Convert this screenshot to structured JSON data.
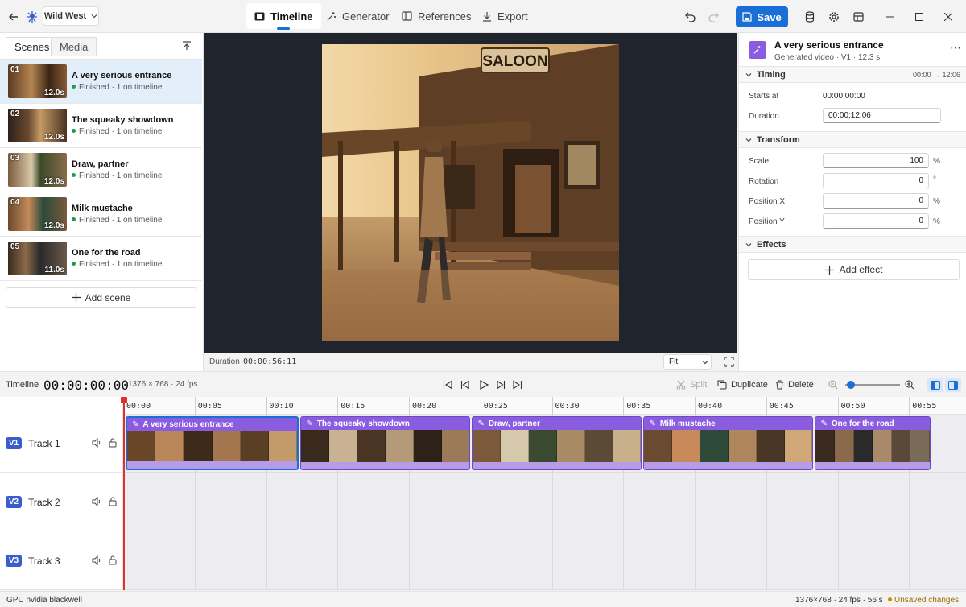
{
  "project": {
    "name": "Wild West"
  },
  "nav": {
    "tabs": [
      {
        "label": "Timeline"
      },
      {
        "label": "Generator"
      },
      {
        "label": "References"
      },
      {
        "label": "Export"
      }
    ],
    "save_label": "Save"
  },
  "left_panel": {
    "tabs": [
      {
        "label": "Scenes"
      },
      {
        "label": "Media"
      }
    ],
    "scenes": [
      {
        "num": "01",
        "title": "A very serious entrance",
        "status": "Finished",
        "detail": "· 1 on timeline",
        "duration": "12.0s"
      },
      {
        "num": "02",
        "title": "The squeaky showdown",
        "status": "Finished",
        "detail": "· 1 on timeline",
        "duration": "12.0s"
      },
      {
        "num": "03",
        "title": "Draw, partner",
        "status": "Finished",
        "detail": "· 1 on timeline",
        "duration": "12.0s"
      },
      {
        "num": "04",
        "title": "Milk mustache",
        "status": "Finished",
        "detail": "· 1 on timeline",
        "duration": "12.0s"
      },
      {
        "num": "05",
        "title": "One for the road",
        "status": "Finished",
        "detail": "· 1 on timeline",
        "duration": "11.0s"
      }
    ],
    "add_scene_label": "Add scene"
  },
  "preview": {
    "sign_text": "SALOON",
    "duration_label": "Duration",
    "duration_value": "00:00:56:11",
    "fit_value": "Fit"
  },
  "inspector": {
    "title": "A very serious entrance",
    "subtitle": "Generated video · V1 · 12.3 s",
    "timing": {
      "label": "Timing",
      "range": "00:00 → 12:06",
      "starts_at_label": "Starts at",
      "starts_at_value": "00:00:00:00",
      "duration_label": "Duration",
      "duration_value": "00:00:12:06"
    },
    "transform": {
      "label": "Transform",
      "scale_label": "Scale",
      "scale_value": "100",
      "scale_unit": "%",
      "rotation_label": "Rotation",
      "rotation_value": "0",
      "rotation_unit": "°",
      "posx_label": "Position X",
      "posx_value": "0",
      "posx_unit": "%",
      "posy_label": "Position Y",
      "posy_value": "0",
      "posy_unit": "%"
    },
    "effects": {
      "label": "Effects",
      "add_label": "Add effect"
    }
  },
  "timeline": {
    "label": "Timeline",
    "timecode": "00:00:00:00",
    "format": "1376 × 768 · 24 fps",
    "split_label": "Split",
    "duplicate_label": "Duplicate",
    "delete_label": "Delete",
    "zoom_level": 0.04,
    "ruler": [
      "00:00",
      "00:05",
      "00:10",
      "00:15",
      "00:20",
      "00:25",
      "00:30",
      "00:35",
      "00:40",
      "00:45",
      "00:50",
      "00:55"
    ],
    "tracks": [
      {
        "badge": "V1",
        "name": "Track 1"
      },
      {
        "badge": "V2",
        "name": "Track 2"
      },
      {
        "badge": "V3",
        "name": "Track 3"
      }
    ],
    "clips": [
      {
        "title": "A very serious entrance",
        "start_s": 0,
        "duration_s": 12.25
      },
      {
        "title": "The squeaky showdown",
        "start_s": 12.25,
        "duration_s": 12.0
      },
      {
        "title": "Draw, partner",
        "start_s": 24.25,
        "duration_s": 12.0
      },
      {
        "title": "Milk mustache",
        "start_s": 36.25,
        "duration_s": 12.0
      },
      {
        "title": "One for the road",
        "start_s": 48.25,
        "duration_s": 8.2
      }
    ]
  },
  "status": {
    "gpu": "GPU nvidia blackwell",
    "info": "1376×768 · 24 fps · 56 s",
    "unsaved": "Unsaved changes"
  },
  "colors": {
    "accent": "#1a6fd6",
    "clip": "#8a5ce0",
    "playhead": "#e0322b",
    "finished": "#1a9b4e",
    "unsaved": "#c98a00"
  }
}
